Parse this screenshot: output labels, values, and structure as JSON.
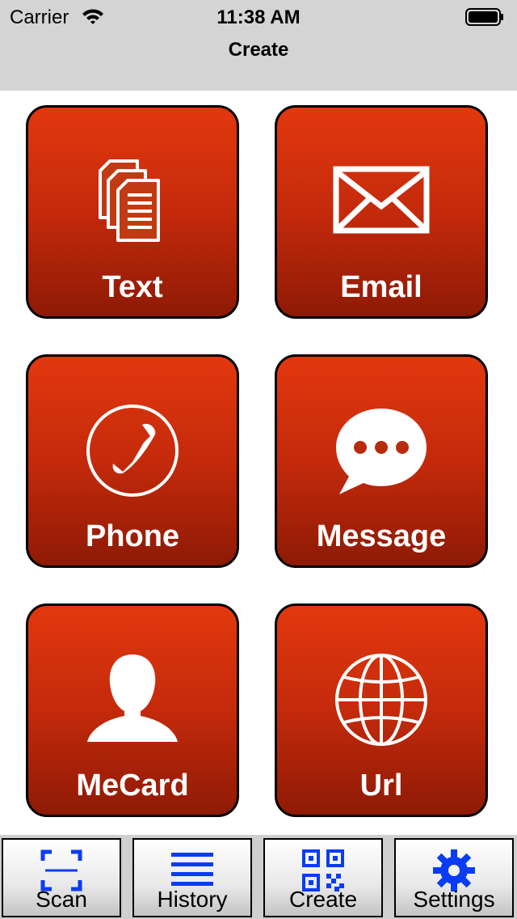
{
  "status": {
    "carrier": "Carrier",
    "time": "11:38 AM"
  },
  "nav": {
    "title": "Create"
  },
  "tiles": [
    {
      "label": "Text",
      "icon": "documents-icon"
    },
    {
      "label": "Email",
      "icon": "envelope-icon"
    },
    {
      "label": "Phone",
      "icon": "phone-icon"
    },
    {
      "label": "Message",
      "icon": "chat-bubble-icon"
    },
    {
      "label": "MeCard",
      "icon": "person-icon"
    },
    {
      "label": "Url",
      "icon": "globe-icon"
    }
  ],
  "tabs": [
    {
      "label": "Scan",
      "icon": "scan-icon"
    },
    {
      "label": "History",
      "icon": "list-icon"
    },
    {
      "label": "Create",
      "icon": "qr-code-icon"
    },
    {
      "label": "Settings",
      "icon": "gear-icon"
    }
  ],
  "colors": {
    "tile_top": "#e2380e",
    "tile_bottom": "#8e1a05",
    "tab_icon_blue": "#0a3cf5",
    "bar_gray": "#d4d4d4"
  }
}
